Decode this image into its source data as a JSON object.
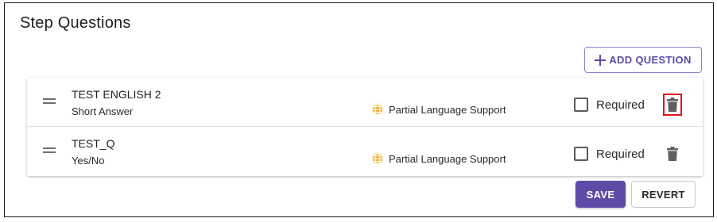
{
  "panel": {
    "title": "Step Questions"
  },
  "toolbar": {
    "add_label": "ADD QUESTION"
  },
  "questions": [
    {
      "name": "TEST ENGLISH 2",
      "type": "Short Answer",
      "language_support": "Partial Language Support",
      "required_label": "Required",
      "required": false
    },
    {
      "name": "TEST_Q",
      "type": "Yes/No",
      "language_support": "Partial Language Support",
      "required_label": "Required",
      "required": false
    }
  ],
  "actions": {
    "save_label": "SAVE",
    "revert_label": "REVERT"
  },
  "icons": {
    "globe": "globe-icon",
    "trash": "trash-icon",
    "drag": "drag-handle-icon",
    "plus": "plus-icon"
  },
  "colors": {
    "accent": "#5e4ba7",
    "globe": "#f2b43a",
    "highlight": "#e0161b"
  }
}
